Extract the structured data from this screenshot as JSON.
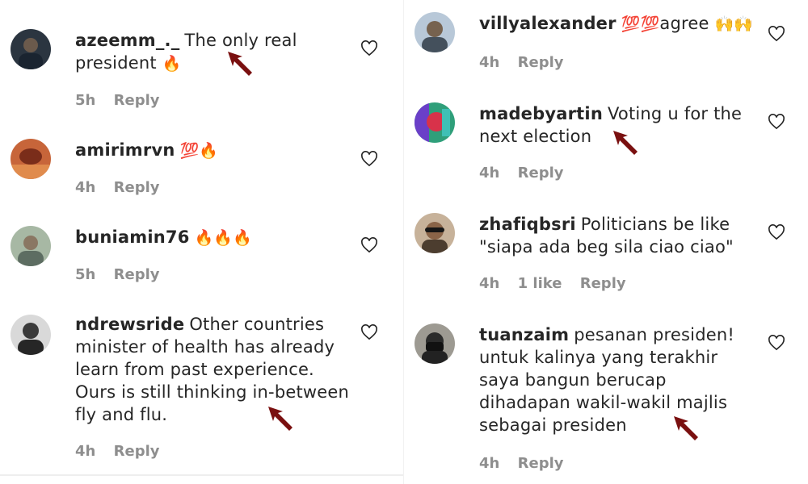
{
  "left_comments": [
    {
      "username": "azeemm_._",
      "text": "The only real president",
      "emoji": "🔥",
      "time": "5h",
      "reply": "Reply",
      "likes": ""
    },
    {
      "username": "amirimrvn",
      "text": "",
      "emoji": "💯🔥",
      "time": "4h",
      "reply": "Reply",
      "likes": ""
    },
    {
      "username": "buniamin76",
      "text": "",
      "emoji": "🔥🔥🔥",
      "time": "5h",
      "reply": "Reply",
      "likes": ""
    },
    {
      "username": "ndrewsride",
      "text": "Other countries minister of health has already learn from past experience. Ours is still thinking in-between fly and flu.",
      "emoji": "",
      "time": "4h",
      "reply": "Reply",
      "likes": ""
    }
  ],
  "right_comments": [
    {
      "username": "villyalexander",
      "text": "agree",
      "emoji_before": "💯💯",
      "emoji_after": "🙌🙌",
      "time": "4h",
      "reply": "Reply",
      "likes": ""
    },
    {
      "username": "madebyartin",
      "text": "Voting u for the next election",
      "time": "4h",
      "reply": "Reply",
      "likes": ""
    },
    {
      "username": "zhafiqbsri",
      "text": "Politicians be like \"siapa ada beg sila ciao ciao\"",
      "time": "4h",
      "reply": "Reply",
      "likes": "1 like"
    },
    {
      "username": "tuanzaim",
      "text": "pesanan presiden! untuk kalinya yang terakhir saya bangun berucap dihadapan wakil-wakil majlis sebagai presiden",
      "time": "4h",
      "reply": "Reply",
      "likes": ""
    }
  ],
  "colors": {
    "arrow": "#7a1010",
    "heart": "#262626",
    "meta": "#8e8e8e"
  },
  "icons": {
    "like": "heart-icon",
    "annotation": "arrow-icon"
  }
}
